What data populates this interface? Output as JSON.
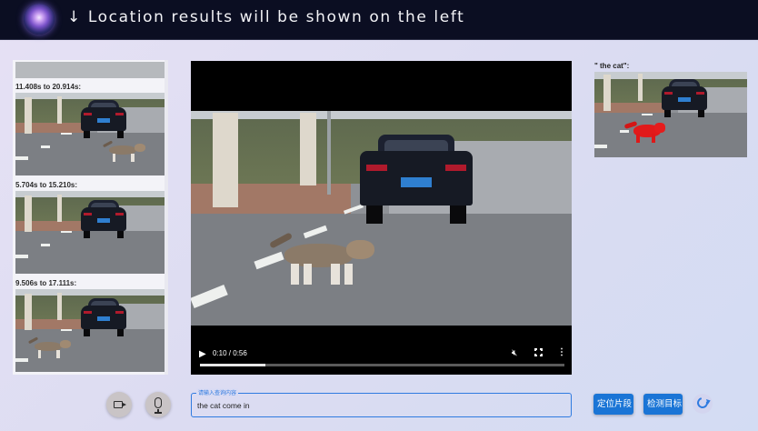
{
  "header": {
    "title": "↓ Location results will be shown on the left"
  },
  "results": [
    {
      "label": "11.408s to 20.914s:"
    },
    {
      "label": "5.704s to 15.210s:"
    },
    {
      "label": "9.506s to 17.111s:"
    }
  ],
  "player": {
    "time": "0:10 / 0:56",
    "progress_fraction": 0.18
  },
  "detection": {
    "label": "\" the cat\":"
  },
  "query": {
    "legend": "请输入查询内容",
    "value": "the cat come in"
  },
  "actions": {
    "locate_label": "定位片段",
    "detect_label": "检测目标"
  },
  "colors": {
    "header_bg": "#0b0e22",
    "accent": "#1a75d6",
    "detection_mask": "#e11a1a"
  },
  "icons": [
    "logo-icon",
    "play-icon",
    "mute-icon",
    "fullscreen-icon",
    "more-icon",
    "camera-icon",
    "mic-icon",
    "refresh-icon"
  ]
}
